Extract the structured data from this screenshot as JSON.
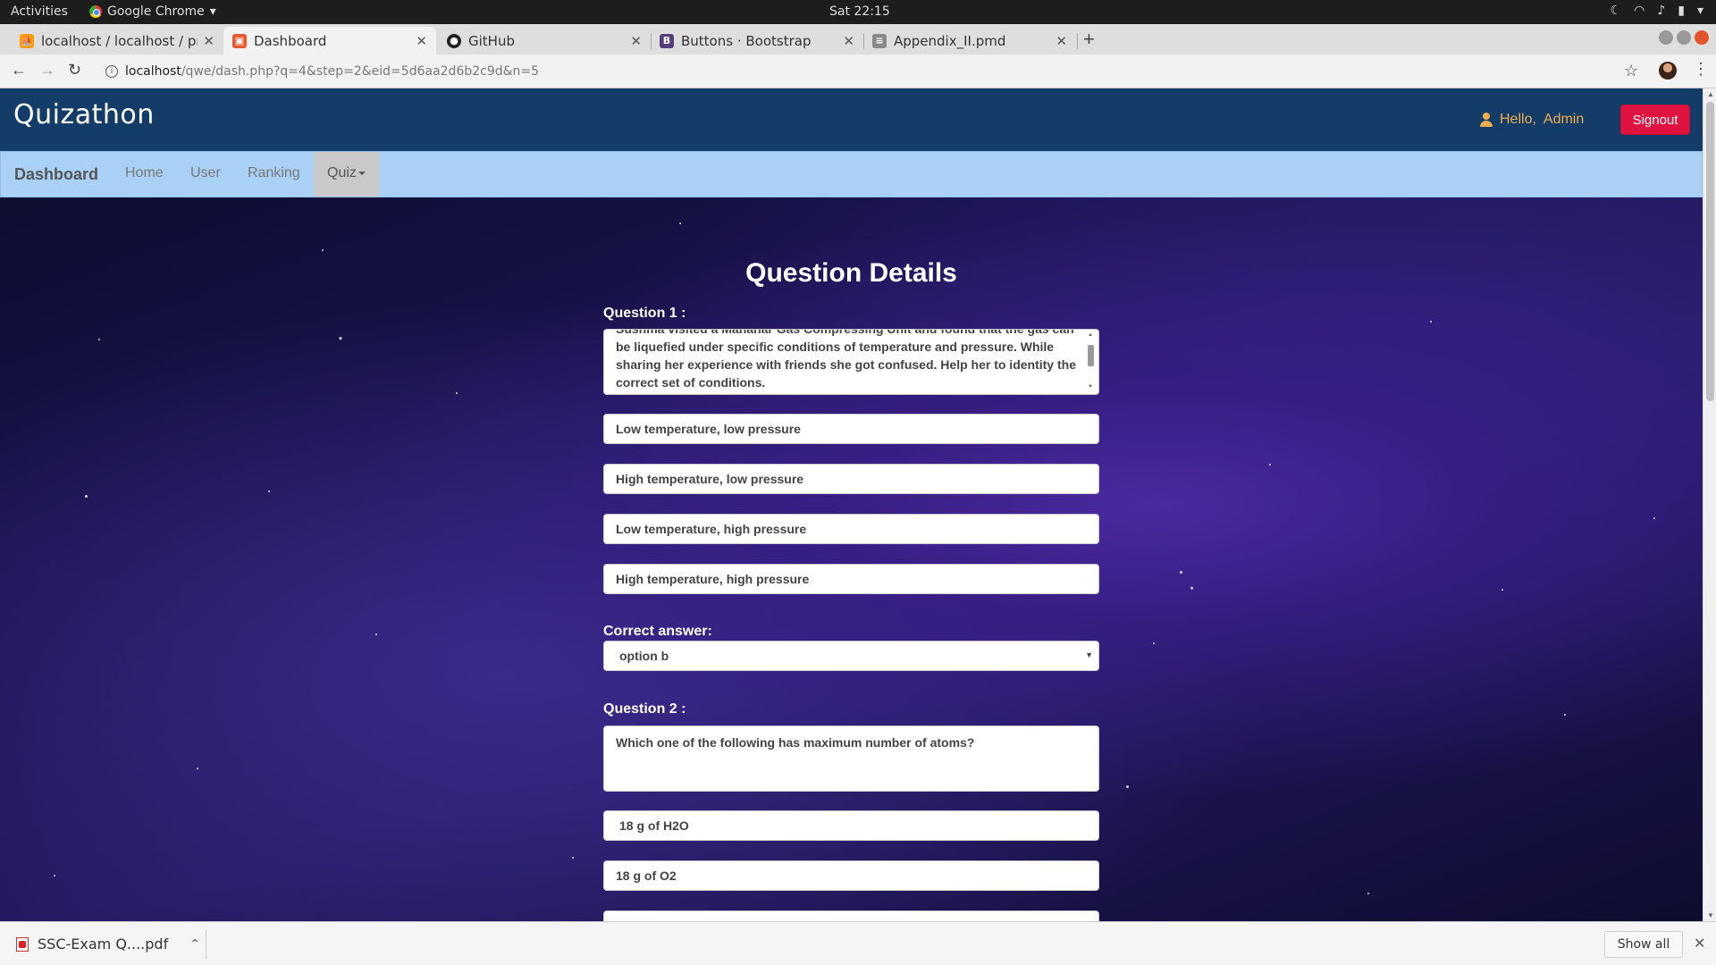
{
  "os": {
    "activities": "Activities",
    "app_name": "Google Chrome",
    "clock": "Sat 22:15"
  },
  "tabs": [
    {
      "label": "localhost / localhost / pro",
      "favicon": "phpmyadmin-icon",
      "active": false
    },
    {
      "label": "Dashboard",
      "favicon": "dashboard-favicon",
      "active": true
    },
    {
      "label": "GitHub",
      "favicon": "github-icon",
      "active": false
    },
    {
      "label": "Buttons · Bootstrap",
      "favicon": "bootstrap-icon",
      "active": false
    },
    {
      "label": "Appendix_II.pmd",
      "favicon": "document-icon",
      "active": false
    }
  ],
  "address": {
    "host": "localhost",
    "path": "/qwe/dash.php?q=4&step=2&eid=5d6aa2d6b2c9d&n=5"
  },
  "header": {
    "logo": "Quizathon",
    "hello": "Hello,",
    "user": "Admin",
    "signout": "Signout"
  },
  "nav": {
    "brand": "Dashboard",
    "links": [
      "Home",
      "User",
      "Ranking"
    ],
    "quiz": "Quiz"
  },
  "form": {
    "title": "Question Details",
    "q1": {
      "label": "Question  1 :",
      "text_top": "Sushma visited a Mahanar Gas Compressing Unit and found that the gas can",
      "text": "be liquefied under specific conditions of temperature and pressure. While sharing her experience with friends she got confused. Help her to identity the correct set of conditions.",
      "options": [
        "Low temperature, low pressure",
        "High temperature, low pressure",
        " Low temperature, high pressure",
        "High temperature, high pressure"
      ],
      "correct_label": "Correct answer:",
      "correct_value": "option b"
    },
    "q2": {
      "label": "Question  2 :",
      "text": "Which one of the following has maximum number of atoms?",
      "options": [
        " 18 g of H2O",
        "18 g of O2"
      ]
    }
  },
  "downloads": {
    "file": "SSC-Exam Q....pdf",
    "show_all": "Show all"
  },
  "colors": {
    "header_bg": "#133d68",
    "navbar_bg": "#a9d1f5",
    "signout": "#e0123f",
    "hello": "#f0ad4e"
  }
}
